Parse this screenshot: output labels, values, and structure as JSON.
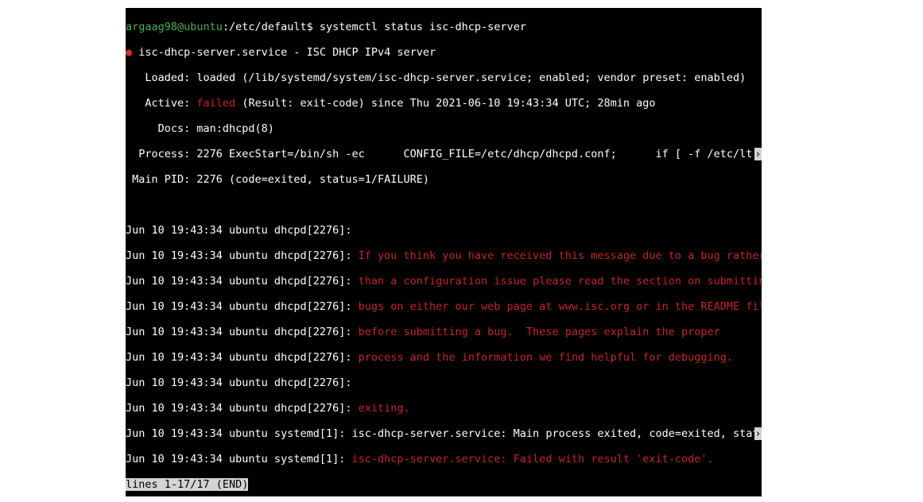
{
  "prompt": {
    "user_host": "argaag98@ubuntu",
    "cwd": ":/etc/default",
    "sep": "$ ",
    "cmd": "systemctl status isc-dhcp-server"
  },
  "status": {
    "bullet": "●",
    "unit": " isc-dhcp-server.service - ISC DHCP IPv4 server",
    "loaded": "   Loaded: loaded (/lib/systemd/system/isc-dhcp-server.service; enabled; vendor preset: enabled)",
    "active_pre": "   Active: ",
    "active_val": "failed",
    "active_post": " (Result: exit-code) since Thu 2021-06-10 19:43:34 UTC; 28min ago",
    "docs": "     Docs: man:dhcpd(8)",
    "process": "  Process: 2276 ExecStart=/bin/sh -ec      CONFIG_FILE=/etc/dhcp/dhcpd.conf;      if [ -f /etc/lt",
    "mainpid": " Main PID: 2276 (code=exited, status=1/FAILURE)"
  },
  "log": {
    "ts_prefix": "Jun 10 19:43:34 ubuntu dhcpd[2276]: ",
    "sys_prefix": "Jun 10 19:43:34 ubuntu systemd[1]: ",
    "l1": "",
    "l2": "If you think you have received this message due to a bug rather",
    "l3": "than a configuration issue please read the section on submitting",
    "l4": "bugs on either our web page at www.isc.org or in the README file",
    "l5": "before submitting a bug.  These pages explain the proper",
    "l6": "process and the information we find helpful for debugging.",
    "l7": "",
    "l8": "exiting.",
    "s1": "isc-dhcp-server.service: Main process exited, code=exited, statu",
    "s2": "isc-dhcp-server.service: Failed with result 'exit-code'."
  },
  "pager": {
    "status": "lines 1-17/17 (END)"
  },
  "arrow": "›"
}
